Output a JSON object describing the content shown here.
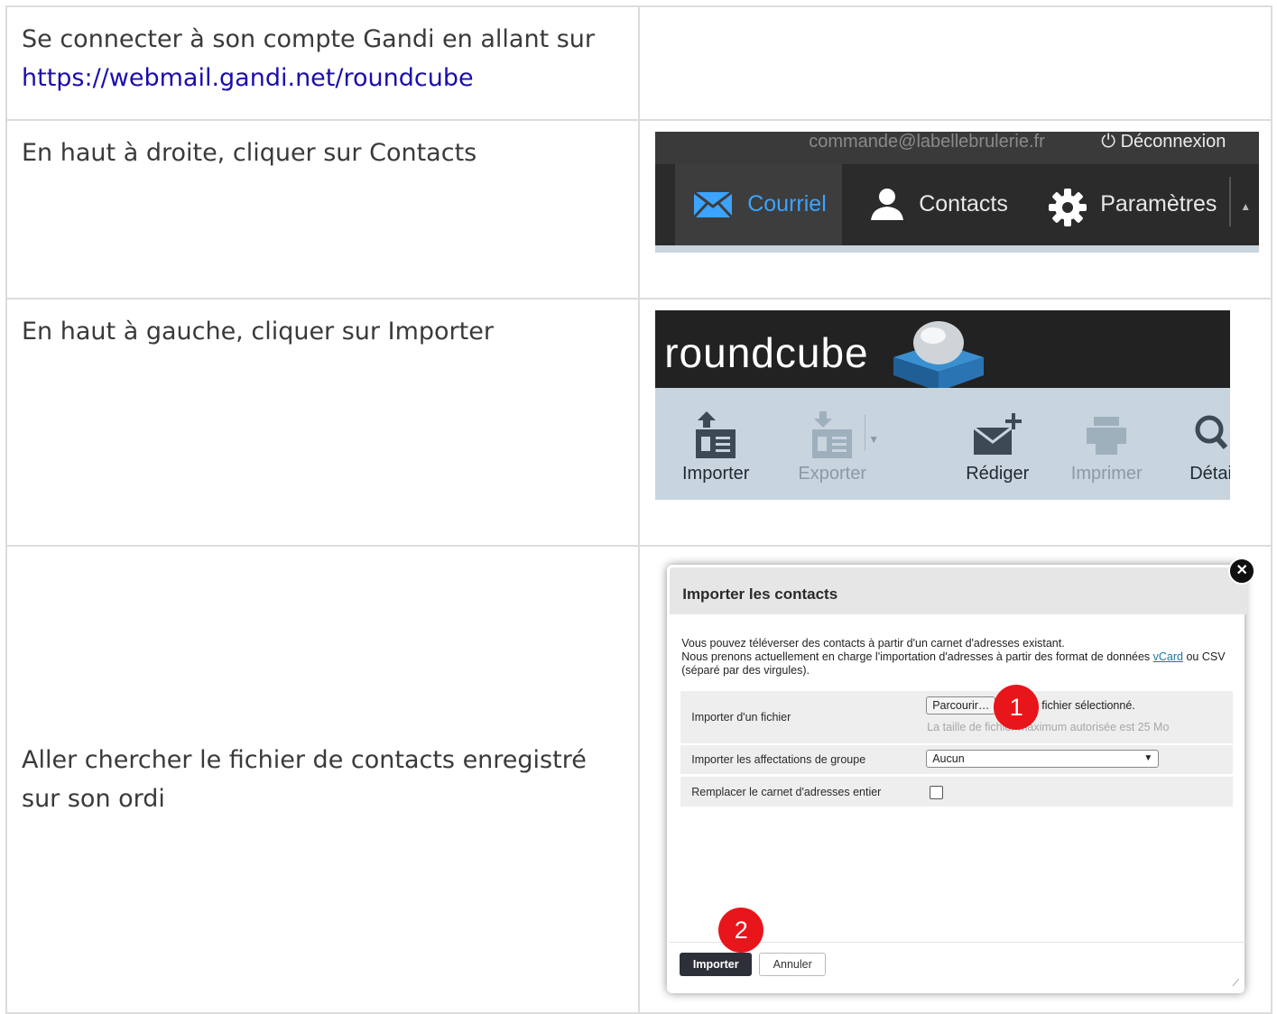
{
  "rows": [
    {
      "text_line1": "Se connecter à son compte Gandi en allant sur",
      "link": "https://webmail.gandi.net/roundcube"
    },
    {
      "text": "En haut à droite, cliquer sur Contacts",
      "screenshot": {
        "user_email": "commande@labellebrulerie.fr",
        "logout": "Déconnexion",
        "tabs": [
          "Courriel",
          "Contacts",
          "Paramètres"
        ],
        "accent": "#3ca3ff"
      }
    },
    {
      "text": "En haut à gauche, cliquer sur Importer",
      "screenshot": {
        "logo": "roundcube",
        "toolbar": [
          "Importer",
          "Exporter",
          "Rédiger",
          "Imprimer",
          "Détai"
        ]
      }
    },
    {
      "text": "Aller chercher le fichier de contacts enregistré sur son ordi",
      "screenshot": {
        "title": "Importer les contacts",
        "desc_line1": "Vous pouvez téléverser des contacts à partir d'un carnet d'adresses existant.",
        "desc_line2_a": "Nous prenons actuellement en charge l'importation d'adresses à partir des format de données ",
        "desc_link": "vCard",
        "desc_line2_b": " ou CSV (séparé par des virgules).",
        "file_label": "Importer d'un fichier",
        "browse_button": "Parcourir…",
        "no_file": "fichier sélectionné.",
        "size_hint": "La taille de fichier maximum autorisée est 25 Mo",
        "group_label": "Importer les affectations de groupe",
        "group_value": "Aucun",
        "replace_label": "Remplacer le carnet d'adresses entier",
        "import_button": "Importer",
        "cancel_button": "Annuler",
        "marker1": "1",
        "marker2": "2",
        "marker_color": "#e8151b"
      }
    }
  ]
}
